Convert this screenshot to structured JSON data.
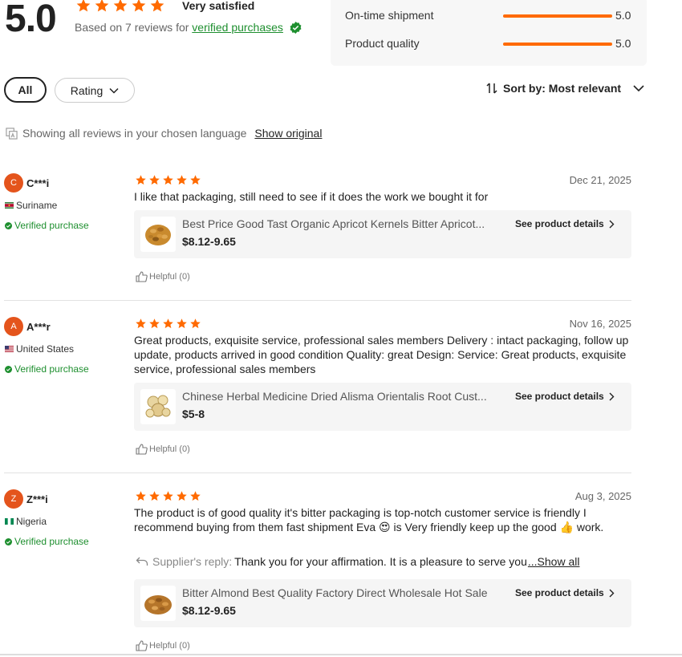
{
  "colors": {
    "accent": "#ff6a00",
    "verified": "#1e8f2f",
    "avatar": "#e4541c"
  },
  "summary": {
    "score": "5.0",
    "label": "Very satisfied",
    "based_on_prefix": "Based on 7 reviews for",
    "verified_link": "verified purchases",
    "stars": 5
  },
  "metrics": [
    {
      "label": "On-time shipment",
      "value": "5.0",
      "fill": 1.0
    },
    {
      "label": "Product quality",
      "value": "5.0",
      "fill": 1.0
    }
  ],
  "filters": {
    "all": "All",
    "rating": "Rating",
    "sort": "Sort by: Most relevant"
  },
  "language": {
    "text": "Showing all reviews in your chosen language",
    "show_original": "Show original"
  },
  "reviews": [
    {
      "initial": "C",
      "name": "C***i",
      "country": "Suriname",
      "verified": "Verified purchase",
      "rating": 5,
      "date": "Dec 21, 2025",
      "text": "I like that packaging, still need to see if it does the work we bought it for",
      "product": {
        "title": "Best Price Good Tast Organic Apricot Kernels Bitter Apricot...",
        "price": "$8.12-9.65",
        "details": "See product details"
      },
      "helpful": "Helpful (0)"
    },
    {
      "initial": "A",
      "name": "A***r",
      "country": "United States",
      "verified": "Verified purchase",
      "rating": 5,
      "date": "Nov 16, 2025",
      "text": "Great products, exquisite service, professional sales members Delivery : intact packaging, follow up update, products arrived in good condition Quality: great Design:  Service: Great products, exquisite service, professional sales members",
      "product": {
        "title": "Chinese Herbal Medicine Dried Alisma Orientalis Root Cust...",
        "price": "$5-8",
        "details": "See product details"
      },
      "helpful": "Helpful (0)"
    },
    {
      "initial": "Z",
      "name": "Z***i",
      "country": "Nigeria",
      "verified": "Verified purchase",
      "rating": 5,
      "date": "Aug 3, 2025",
      "text": "The product is of good quality it's bitter packaging is top-notch customer service is friendly I recommend buying from them fast shipment Eva 😍 is Very friendly keep up the good 👍 work.",
      "reply": {
        "label": "Supplier's reply:",
        "text": "Thank you for your affirmation. It is a pleasure to serve you",
        "show_all": "...Show all"
      },
      "product": {
        "title": "Bitter Almond Best Quality Factory Direct Wholesale Hot Sale",
        "price": "$8.12-9.65",
        "details": "See product details"
      },
      "helpful": "Helpful (0)"
    }
  ]
}
